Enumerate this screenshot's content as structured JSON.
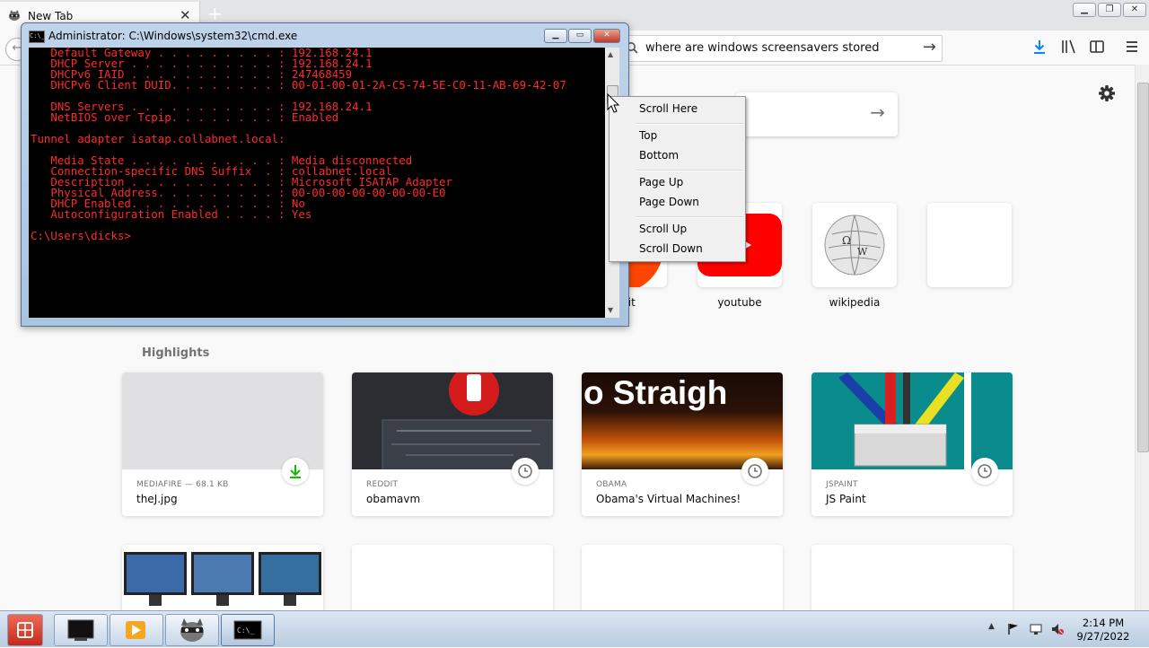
{
  "browser": {
    "tab": {
      "title": "New Tab",
      "close": "✕"
    },
    "new_tab": "+",
    "window_controls": {
      "minimize": "▁",
      "restore": "❐",
      "close": "✕"
    },
    "url_bar": {
      "text": "where are windows screensavers stored",
      "go": "→"
    },
    "back": "←"
  },
  "newtab": {
    "search_arrow": "→",
    "top_sites": [
      {
        "label": "dit"
      },
      {
        "label": "youtube"
      },
      {
        "label": "wikipedia"
      },
      {
        "label": ""
      }
    ],
    "highlights_title": "Highlights",
    "highlights": [
      {
        "context": "MEDIAFIRE — 68.1 KB",
        "title": "theJ.jpg",
        "badge": "download-icon"
      },
      {
        "context": "REDDIT",
        "title": "obamavm",
        "badge": "clock-icon"
      },
      {
        "context": "OBAMA",
        "title": "Obama's Virtual Machines!",
        "badge": "clock-icon",
        "image_text": "o Straigh"
      },
      {
        "context": "JSPAINT",
        "title": "JS Paint",
        "badge": "clock-icon"
      }
    ]
  },
  "cmd": {
    "title": "Administrator: C:\\Windows\\system32\\cmd.exe",
    "icon_text": "C:\\_",
    "lines": [
      "   Default Gateway . . . . . . . . . : 192.168.24.1",
      "   DHCP Server . . . . . . . . . . . : 192.168.24.1",
      "   DHCPv6 IAID . . . . . . . . . . . : 247468459",
      "   DHCPv6 Client DUID. . . . . . . . : 00-01-00-01-2A-C5-74-5E-C0-11-AB-69-42-07",
      "",
      "   DNS Servers . . . . . . . . . . . : 192.168.24.1",
      "   NetBIOS over Tcpip. . . . . . . . : Enabled",
      "",
      "Tunnel adapter isatap.collabnet.local:",
      "",
      "   Media State . . . . . . . . . . . : Media disconnected",
      "   Connection-specific DNS Suffix  . : collabnet.local",
      "   Description . . . . . . . . . . . : Microsoft ISATAP Adapter",
      "   Physical Address. . . . . . . . . : 00-00-00-00-00-00-00-E0",
      "   DHCP Enabled. . . . . . . . . . . : No",
      "   Autoconfiguration Enabled . . . . : Yes",
      "",
      "C:\\Users\\dicks>"
    ],
    "text_color": "#ff2a2a"
  },
  "context_menu": {
    "items": [
      "Scroll Here",
      "Top",
      "Bottom",
      "Page Up",
      "Page Down",
      "Scroll Up",
      "Scroll Down"
    ]
  },
  "taskbar": {
    "clock": {
      "time": "2:14 PM",
      "date": "9/27/2022"
    },
    "items": [
      "start-button",
      "terminal-app",
      "media-player-app",
      "raccoon-app",
      "cmd-app"
    ]
  }
}
